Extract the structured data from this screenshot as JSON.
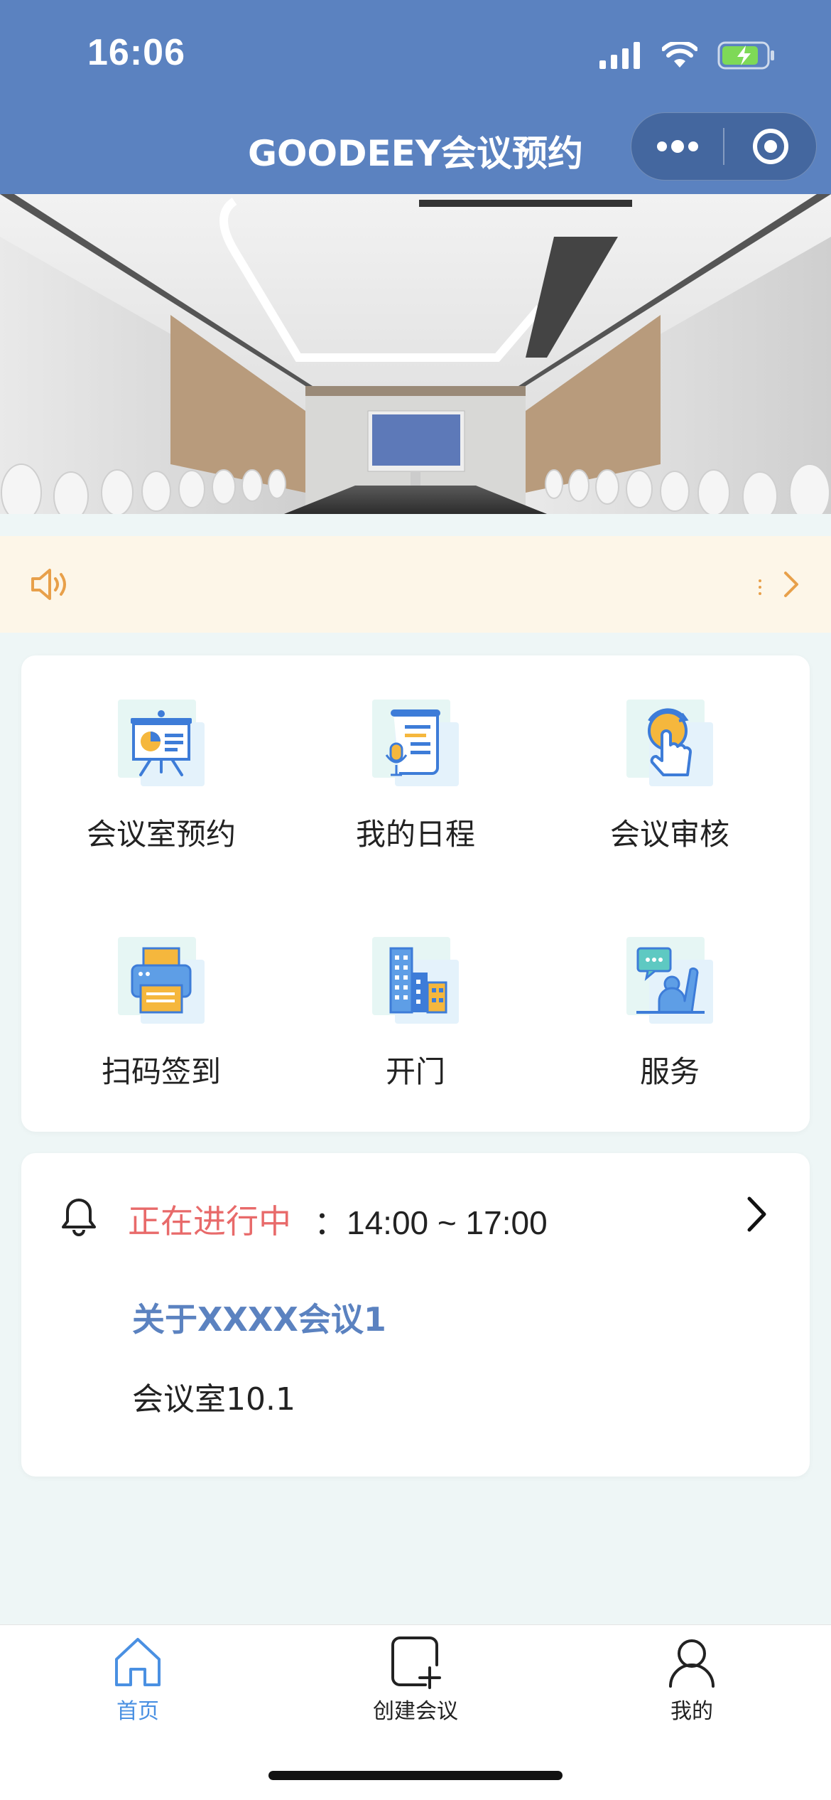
{
  "status_bar": {
    "time": "16:06"
  },
  "nav": {
    "title": "GOODEEY会议预约"
  },
  "notice": {
    "text": "",
    "icon": "speaker-icon"
  },
  "grid": [
    {
      "label": "会议室预约",
      "icon": "presentation-board-icon"
    },
    {
      "label": "我的日程",
      "icon": "schedule-scroll-icon"
    },
    {
      "label": "会议审核",
      "icon": "tap-approve-icon"
    },
    {
      "label": "扫码签到",
      "icon": "printer-icon"
    },
    {
      "label": "开门",
      "icon": "building-icon"
    },
    {
      "label": "服务",
      "icon": "service-chat-icon"
    }
  ],
  "meeting": {
    "status": "正在进行中",
    "time": "：14:00 ~ 17:00",
    "title": "关于XXXX会议1",
    "room": "会议室10.1"
  },
  "tabbar": [
    {
      "label": "首页",
      "icon": "home-icon",
      "active": true
    },
    {
      "label": "创建会议",
      "icon": "add-meeting-icon",
      "active": false
    },
    {
      "label": "我的",
      "icon": "user-icon",
      "active": false
    }
  ],
  "colors": {
    "primary": "#5b82c0",
    "status_red": "#e86a6a",
    "notice_bg": "#fdf6e8",
    "notice_icon": "#e8a04a",
    "page_bg": "#eef6f6"
  }
}
